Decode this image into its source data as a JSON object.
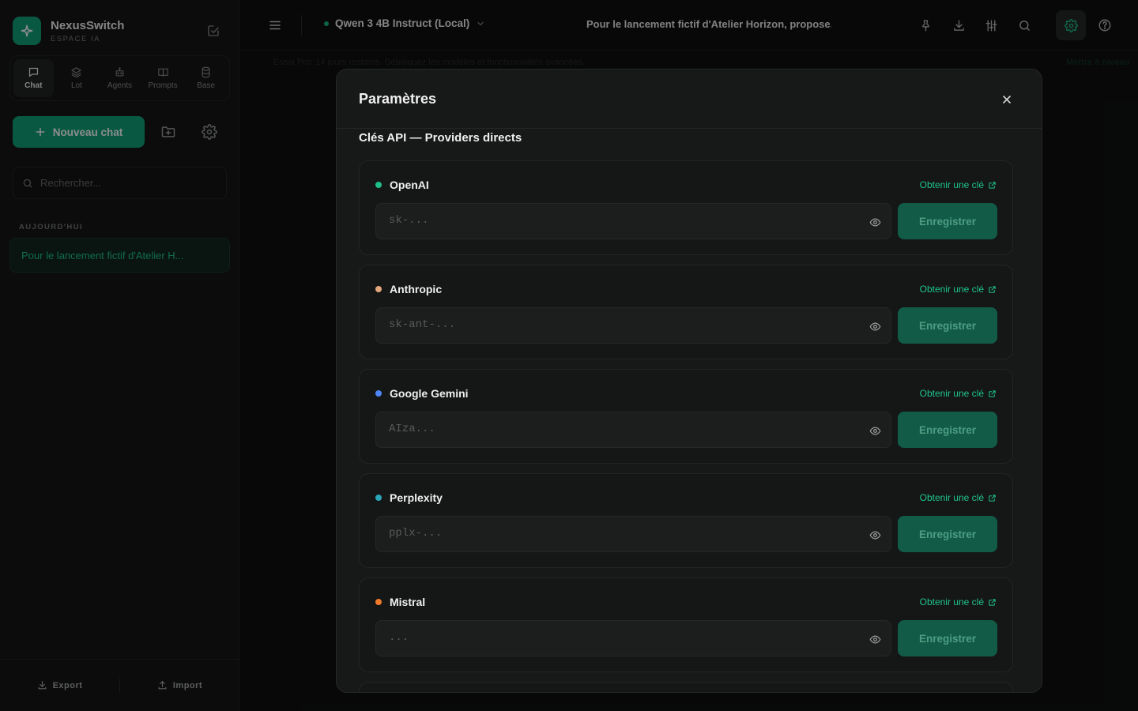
{
  "brand": {
    "name": "NexusSwitch",
    "subtitle": "ESPACE IA"
  },
  "nav_tabs": [
    {
      "label": "Chat",
      "icon": "chat-icon",
      "active": true
    },
    {
      "label": "Lot",
      "icon": "layers-icon",
      "active": false
    },
    {
      "label": "Agents",
      "icon": "robot-icon",
      "active": false
    },
    {
      "label": "Prompts",
      "icon": "book-icon",
      "active": false
    },
    {
      "label": "Base",
      "icon": "database-icon",
      "active": false
    }
  ],
  "sidebar": {
    "new_chat_label": "Nouveau chat",
    "search_placeholder": "Rechercher...",
    "section_today": "AUJOURD'HUI",
    "conversations": [
      {
        "title": "Pour le lancement fictif d'Atelier H..."
      }
    ],
    "export_label": "Export",
    "import_label": "Import"
  },
  "topbar": {
    "model_name": "Qwen 3 4B Instruct (Local)",
    "conversation_title": "Pour le lancement fictif d'Atelier Horizon, propose..."
  },
  "banner": {
    "text": "Essai Pro: 14 jours restants. Débloquez les modèles et fonctionnalités avancées.",
    "link": "Mettre à niveau"
  },
  "settings_modal": {
    "title": "Paramètres",
    "section_title": "Clés API — Providers directs",
    "get_key_label": "Obtenir une clé",
    "save_label": "Enregistrer",
    "providers": [
      {
        "name": "OpenAI",
        "placeholder": "sk-...",
        "dot_color": "#1fbf8a"
      },
      {
        "name": "Anthropic",
        "placeholder": "sk-ant-...",
        "dot_color": "#e3a77c"
      },
      {
        "name": "Google Gemini",
        "placeholder": "AIza...",
        "dot_color": "#4f86f7"
      },
      {
        "name": "Perplexity",
        "placeholder": "pplx-...",
        "dot_color": "#2aa6b8"
      },
      {
        "name": "Mistral",
        "placeholder": "...",
        "dot_color": "#f07a2c"
      }
    ]
  },
  "colors": {
    "accent": "#12a279",
    "accent_text": "#1fc48f",
    "save_button": "#125c47"
  }
}
